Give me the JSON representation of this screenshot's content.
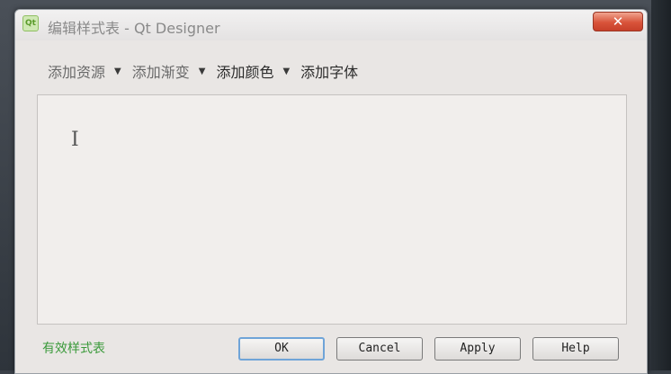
{
  "window": {
    "title": "编辑样式表 - Qt Designer",
    "app_icon_text": "Qt",
    "close_label": "✕"
  },
  "toolbar": {
    "items": [
      {
        "label": "添加资源",
        "has_dropdown": true
      },
      {
        "label": "添加渐变",
        "has_dropdown": true
      },
      {
        "label": "添加颜色",
        "has_dropdown": true
      },
      {
        "label": "添加字体",
        "has_dropdown": false
      }
    ],
    "dropdown_glyph": "▼"
  },
  "editor": {
    "value": "",
    "cursor_glyph": "I"
  },
  "status": {
    "text": "有效样式表",
    "color": "#3b9a3b"
  },
  "buttons": {
    "ok": "OK",
    "cancel": "Cancel",
    "apply": "Apply",
    "help": "Help"
  }
}
